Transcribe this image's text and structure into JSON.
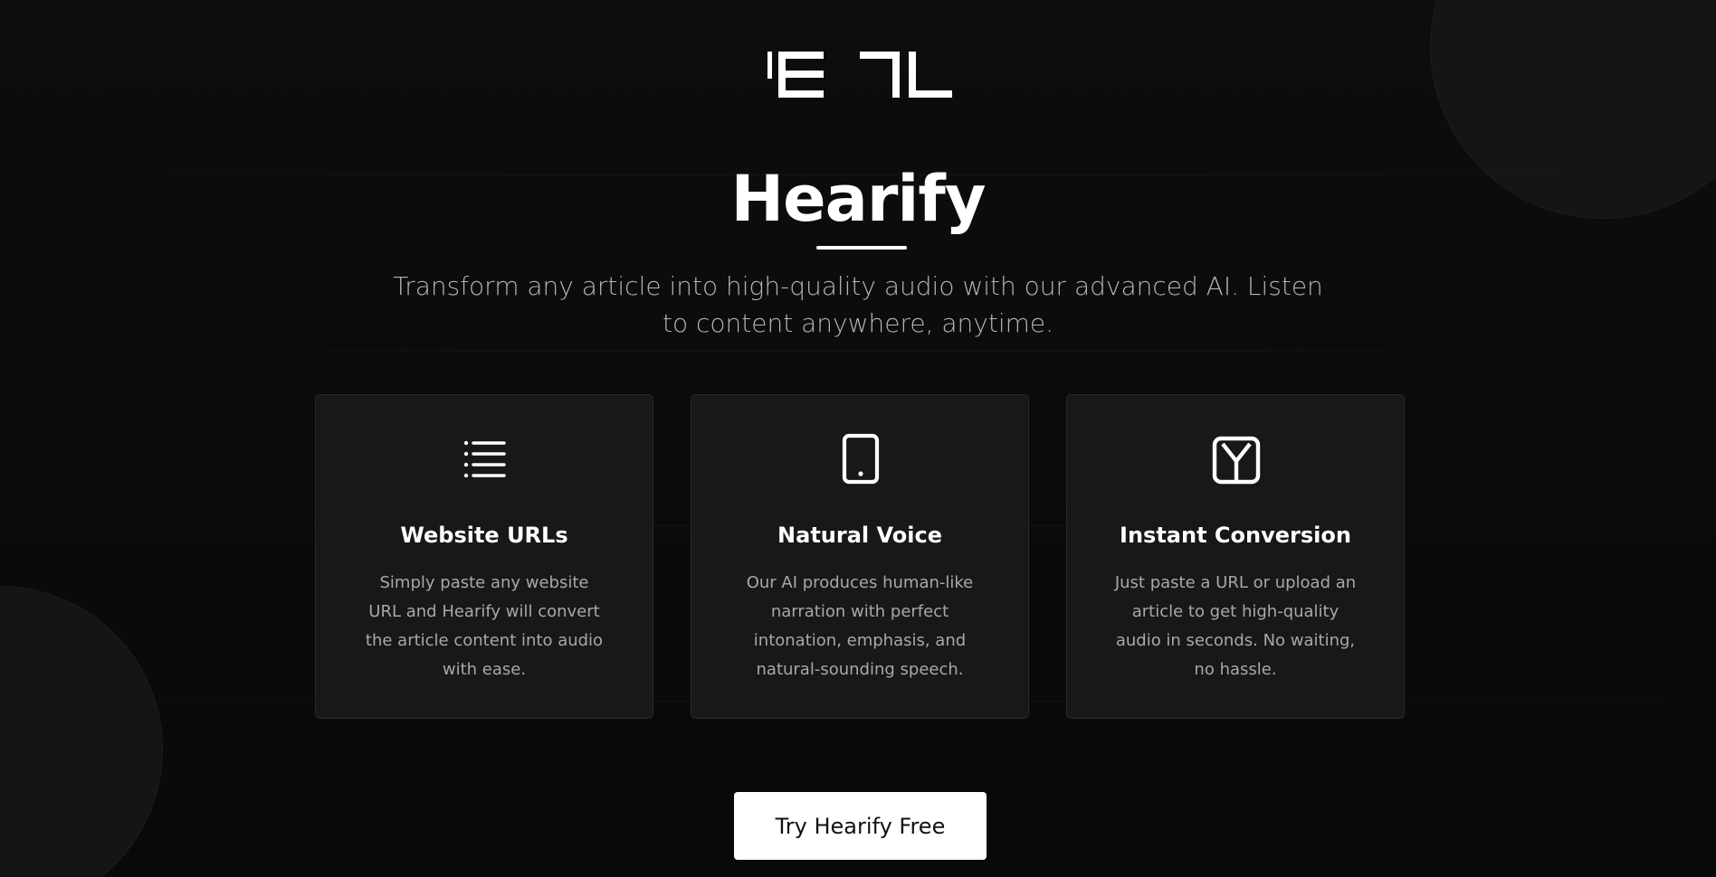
{
  "brand": {
    "logo_icon": "el-logo-icon",
    "title": "Hearify",
    "tagline": "Transform any article into high-quality audio with our advanced AI. Listen to content anywhere, anytime."
  },
  "features": [
    {
      "icon": "list-icon",
      "title": "Website URLs",
      "description": "Simply paste any website URL and Hearify will convert the article content into audio with ease."
    },
    {
      "icon": "tablet-icon",
      "title": "Natural Voice",
      "description": "Our AI produces human-like narration with perfect intonation, emphasis, and natural-sounding speech."
    },
    {
      "icon": "y-box-icon",
      "title": "Instant Conversion",
      "description": "Just paste a URL or upload an article to get high-quality audio in seconds. No waiting, no hassle."
    }
  ],
  "cta": {
    "label": "Try Hearify Free"
  },
  "colors": {
    "background": "#0b0b0b",
    "card": "#181818",
    "accent": "#ffffff",
    "muted_text": "#a8a8a8"
  }
}
